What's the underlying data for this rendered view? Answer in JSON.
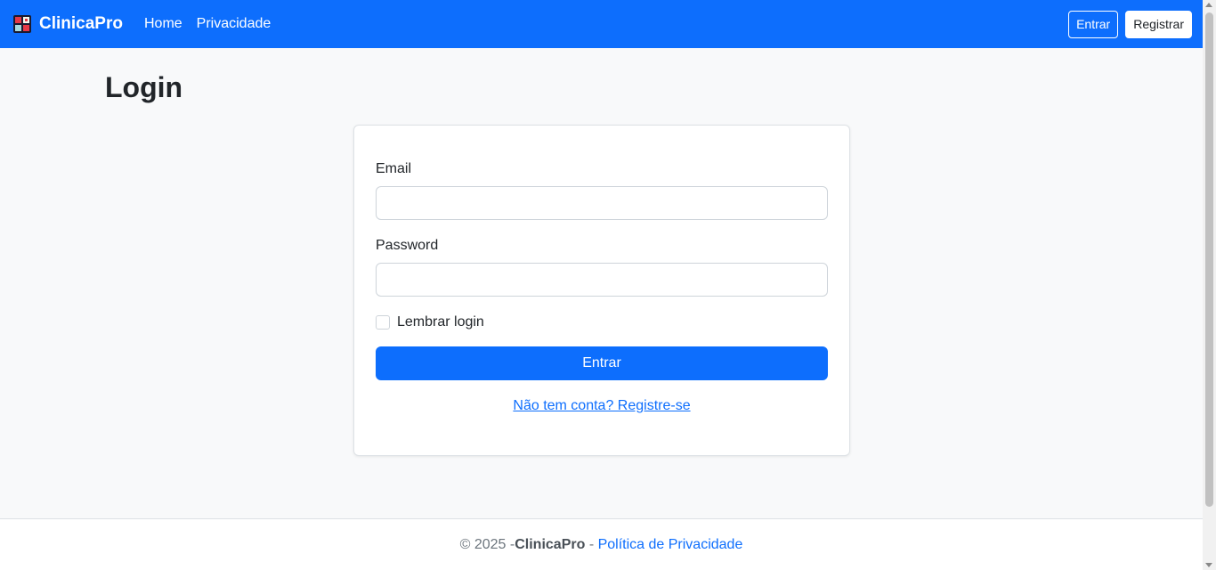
{
  "navbar": {
    "brand": "ClinicaPro",
    "brand_icon": "clinic-logo-icon",
    "links": [
      "Home",
      "Privacidade"
    ],
    "login_label": "Entrar",
    "register_label": "Registrar"
  },
  "page": {
    "title": "Login"
  },
  "form": {
    "email_label": "Email",
    "email_value": "",
    "password_label": "Password",
    "password_value": "",
    "remember_label": "Lembrar login",
    "remember_checked": false,
    "submit_label": "Entrar",
    "register_link": "Não tem conta? Registre-se"
  },
  "footer": {
    "copyright": "© 2025 - ",
    "brand": "ClinicaPro",
    "separator": " - ",
    "privacy_link": "Política de Privacidade"
  },
  "colors": {
    "primary": "#0d6efd",
    "background": "#f8f9fa"
  }
}
